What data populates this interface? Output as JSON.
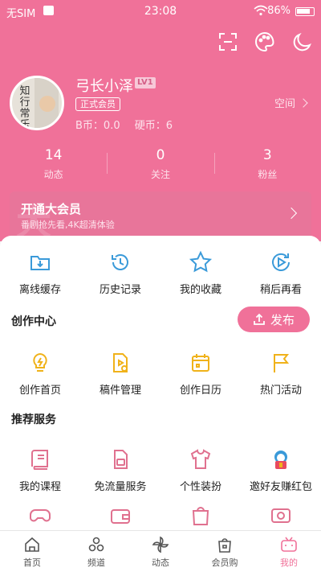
{
  "status_bar": {
    "carrier": "无SIM",
    "time": "23:08",
    "battery": "86%"
  },
  "profile": {
    "avatar_text": "知行常乐",
    "username": "弓长小泽",
    "level": "LV1",
    "member_tag": "正式会员",
    "b_coin": "B币：0.0",
    "coin": "硬币：6",
    "space_link": "空间"
  },
  "stats": [
    {
      "value": "14",
      "label": "动态"
    },
    {
      "value": "0",
      "label": "关注"
    },
    {
      "value": "3",
      "label": "粉丝"
    }
  ],
  "vip": {
    "title": "开通大会员",
    "subtitle": "番剧抢先看,4K超清体验"
  },
  "quick_actions": [
    {
      "label": "离线缓存",
      "icon": "download-folder-icon"
    },
    {
      "label": "历史记录",
      "icon": "history-icon"
    },
    {
      "label": "我的收藏",
      "icon": "star-icon"
    },
    {
      "label": "稍后再看",
      "icon": "watch-later-icon"
    }
  ],
  "creation": {
    "title": "创作中心",
    "publish_label": "发布",
    "items": [
      {
        "label": "创作首页",
        "icon": "bulb-icon"
      },
      {
        "label": "稿件管理",
        "icon": "manuscript-icon"
      },
      {
        "label": "创作日历",
        "icon": "calendar-icon"
      },
      {
        "label": "热门活动",
        "icon": "flag-icon"
      }
    ]
  },
  "services": {
    "title": "推荐服务",
    "items": [
      {
        "label": "我的课程",
        "icon": "course-book-icon"
      },
      {
        "label": "免流量服务",
        "icon": "sim-card-icon"
      },
      {
        "label": "个性装扮",
        "icon": "tshirt-icon"
      },
      {
        "label": "邀好友赚红包",
        "icon": "invite-mascot-icon"
      }
    ],
    "more_icons": [
      "gamepad-icon",
      "wallet-icon",
      "shop-bag-icon",
      "tv-icon"
    ]
  },
  "tabs": [
    {
      "label": "首页",
      "icon": "home-icon"
    },
    {
      "label": "频道",
      "icon": "channel-icon"
    },
    {
      "label": "动态",
      "icon": "pinwheel-icon"
    },
    {
      "label": "会员购",
      "icon": "shopping-bag-icon"
    },
    {
      "label": "我的",
      "icon": "tv-mascot-icon",
      "active": true
    }
  ],
  "colors": {
    "brand_pink": "#f07199",
    "icon_blue": "#3a9ad9",
    "icon_yellow": "#f0b21a",
    "icon_pink": "#e0718f"
  }
}
